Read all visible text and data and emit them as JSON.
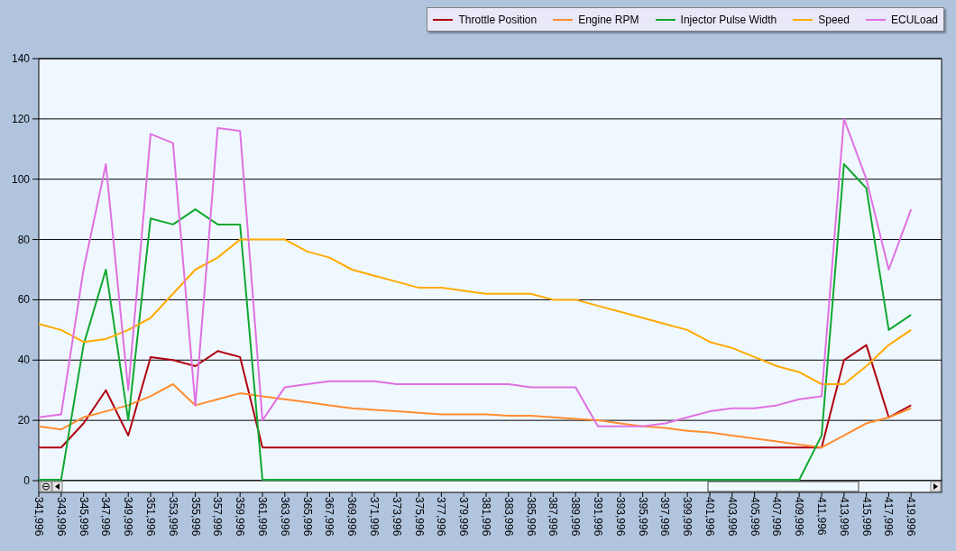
{
  "chart_data": {
    "type": "line",
    "categories": [
      "341,996",
      "343,996",
      "345,996",
      "347,996",
      "349,996",
      "351,996",
      "353,996",
      "355,996",
      "357,996",
      "359,996",
      "361,996",
      "363,996",
      "365,996",
      "367,996",
      "369,996",
      "371,996",
      "373,996",
      "375,996",
      "377,996",
      "379,996",
      "381,996",
      "383,996",
      "385,996",
      "387,996",
      "389,996",
      "391,996",
      "393,996",
      "395,996",
      "397,996",
      "399,996",
      "401,996",
      "403,996",
      "405,996",
      "407,996",
      "409,996",
      "411,996",
      "413,996",
      "415,996",
      "417,996",
      "419,996"
    ],
    "series": [
      {
        "name": "Throttle Position",
        "color": "#b00010",
        "values": [
          11,
          11,
          19,
          30,
          15,
          41,
          40,
          38,
          43,
          41,
          11,
          11,
          11,
          11,
          11,
          11,
          11,
          11,
          11,
          11,
          11,
          11,
          11,
          11,
          11,
          11,
          11,
          11,
          11,
          11,
          11,
          11,
          11,
          11,
          11,
          11,
          40,
          45,
          21,
          25
        ]
      },
      {
        "name": "Engine RPM",
        "color": "#ff8c30",
        "values": [
          18,
          17,
          21,
          23,
          25,
          28,
          32,
          25,
          27,
          29,
          28,
          27,
          26,
          25,
          24,
          23.5,
          23,
          22.5,
          22,
          22,
          22,
          21.5,
          21.5,
          21,
          20.5,
          20,
          19,
          18,
          17.5,
          16.5,
          16,
          15,
          14,
          13,
          12,
          11,
          15,
          19,
          21,
          24
        ]
      },
      {
        "name": "Injector Pulse Width",
        "color": "#10a830",
        "values": [
          0,
          0,
          45,
          70,
          20,
          87,
          85,
          90,
          85,
          85,
          0,
          0,
          0,
          0,
          0,
          0,
          0,
          0,
          0,
          0,
          0,
          0,
          0,
          0,
          0,
          0,
          0,
          0,
          0,
          0,
          0,
          0,
          0,
          0,
          0,
          15,
          105,
          97,
          50,
          55
        ]
      },
      {
        "name": "Speed",
        "color": "#ffaa00",
        "values": [
          52,
          50,
          46,
          47,
          50,
          54,
          62,
          70,
          74,
          80,
          80,
          80,
          76,
          74,
          70,
          68,
          66,
          64,
          64,
          63,
          62,
          62,
          62,
          60,
          60,
          58,
          56,
          54,
          52,
          50,
          46,
          44,
          41,
          38,
          36,
          32,
          32,
          38,
          45,
          50
        ]
      },
      {
        "name": "ECULoad",
        "color": "#e070e0",
        "values": [
          21,
          22,
          70,
          105,
          30,
          115,
          112,
          25,
          117,
          116,
          20,
          31,
          32,
          33,
          33,
          33,
          32,
          32,
          32,
          32,
          32,
          32,
          31,
          31,
          31,
          18,
          18,
          18,
          19,
          21,
          23,
          24,
          24,
          25,
          27,
          28,
          120,
          100,
          70,
          90
        ]
      }
    ],
    "grid": true,
    "ylim": [
      0,
      140
    ],
    "yticks": [
      0,
      20,
      40,
      60,
      80,
      100,
      120,
      140
    ]
  }
}
